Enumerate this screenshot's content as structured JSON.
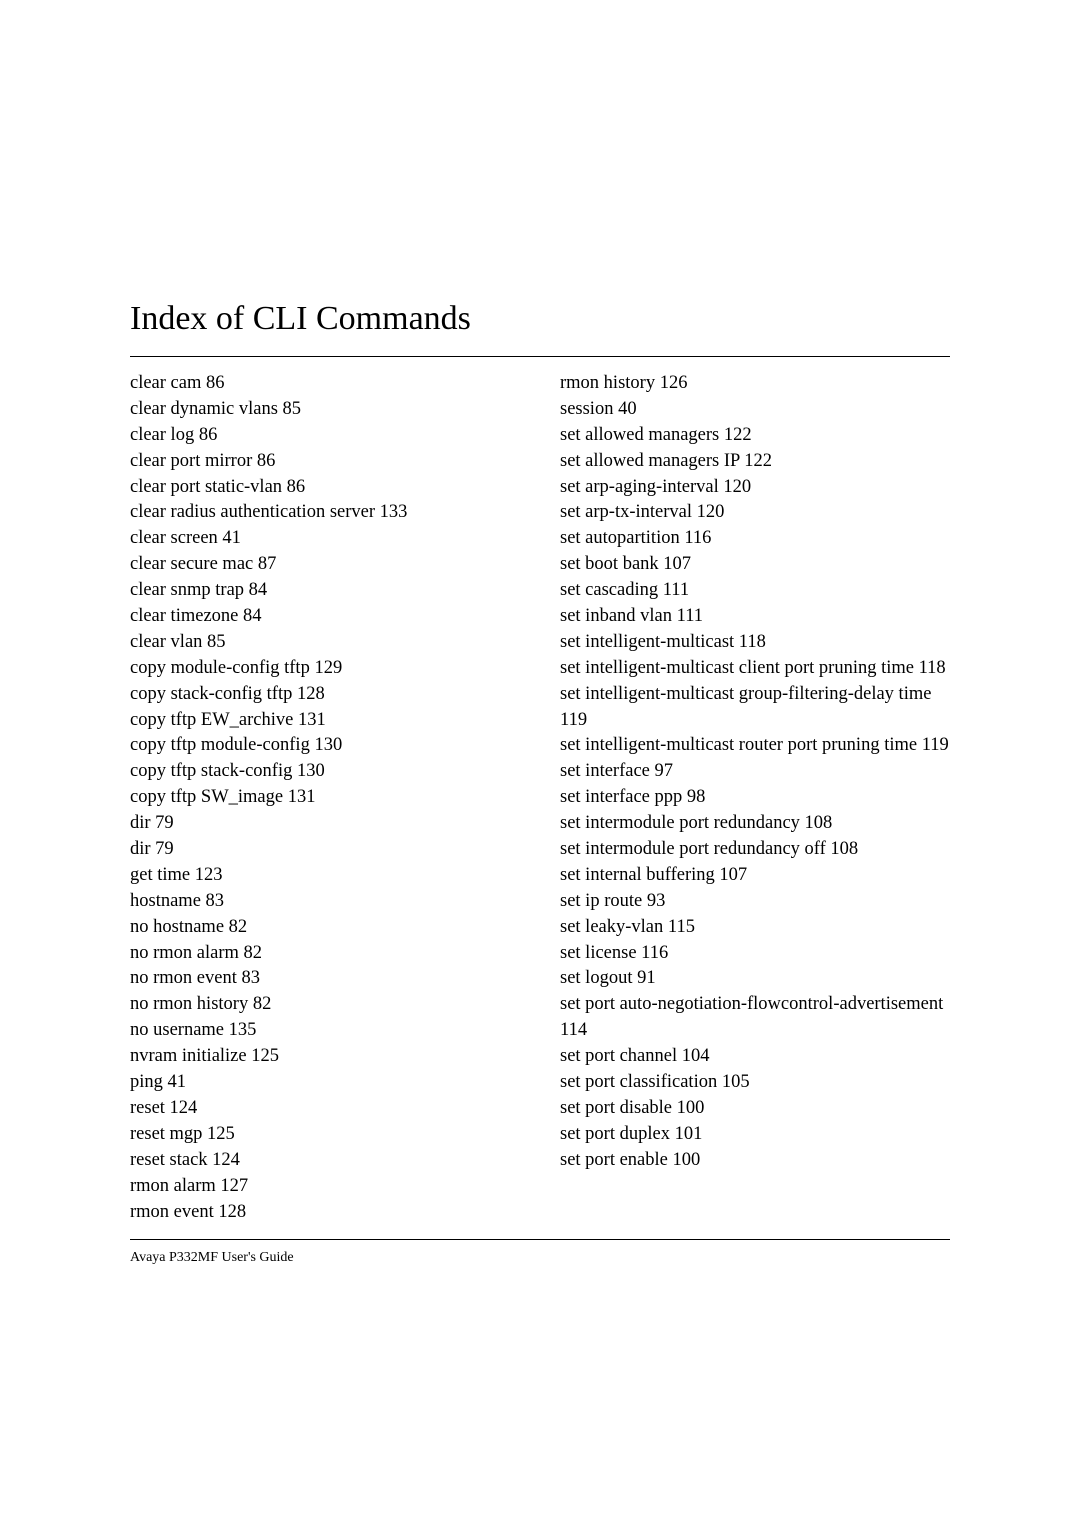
{
  "title": "Index of CLI Commands",
  "footer": "Avaya P332MF User's Guide",
  "left_column": [
    "clear cam 86",
    "clear dynamic vlans 85",
    "clear log 86",
    "clear port mirror 86",
    "clear port static-vlan 86",
    "clear radius authentication server 133",
    "clear screen 41",
    "clear secure mac 87",
    "clear snmp trap 84",
    "clear timezone 84",
    "clear vlan 85",
    "copy module-config tftp 129",
    "copy stack-config tftp 128",
    "copy tftp EW_archive 131",
    "copy tftp module-config 130",
    "copy tftp stack-config 130",
    "copy tftp SW_image 131",
    "dir 79",
    "dir 79",
    "get time 123",
    "hostname 83",
    "no hostname 82",
    "no rmon alarm 82",
    "no rmon event 83",
    "no rmon history 82",
    "no username 135",
    "nvram initialize 125",
    "ping 41",
    "reset 124",
    "reset mgp 125",
    "reset stack 124",
    "rmon alarm 127",
    "rmon event 128"
  ],
  "right_column": [
    "rmon history 126",
    "session 40",
    "set allowed managers 122",
    "set allowed managers IP 122",
    "set arp-aging-interval 120",
    "set arp-tx-interval 120",
    "set autopartition 116",
    "set boot bank 107",
    "set cascading 111",
    "set inband vlan 111",
    "set intelligent-multicast 118",
    "set intelligent-multicast client port pruning time 118",
    "set intelligent-multicast group-filtering-delay time 119",
    "set intelligent-multicast router port pruning time 119",
    "set interface 97",
    "set interface ppp 98",
    "set intermodule port redundancy 108",
    "set intermodule port redundancy off 108",
    "set internal buffering 107",
    "set ip route 93",
    "set leaky-vlan 115",
    "set license 116",
    "set logout 91",
    "set port auto-negotiation-flowcontrol-advertisement 114",
    "set port channel 104",
    "set port classification 105",
    "set port disable 100",
    "set port duplex 101",
    "set port enable 100"
  ]
}
